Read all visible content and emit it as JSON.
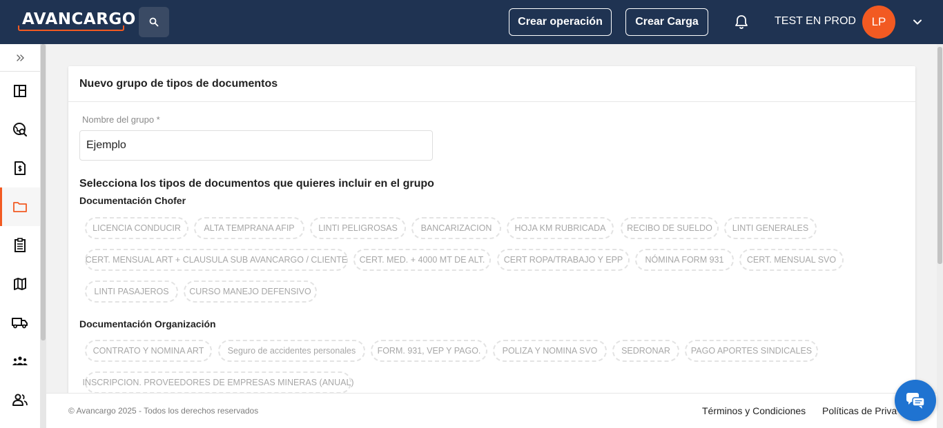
{
  "header": {
    "logo_text": "AVANCARGO",
    "search_icon": "search-icon",
    "create_operation_label": "Crear operación",
    "create_load_label": "Crear Carga",
    "notification_icon": "bell-icon",
    "user_name": "TEST EN PROD",
    "avatar_initials": "LP",
    "menu_icon": "chevron-down-icon"
  },
  "sidebar": {
    "expand_icon": "double-chevron-right-icon",
    "items": [
      {
        "icon": "dashboard-icon",
        "active": false
      },
      {
        "icon": "globe-search-icon",
        "active": false
      },
      {
        "icon": "invoice-icon",
        "active": false
      },
      {
        "icon": "folder-icon",
        "active": true
      },
      {
        "icon": "clipboard-icon",
        "active": false
      },
      {
        "icon": "map-icon",
        "active": false
      },
      {
        "icon": "truck-icon",
        "active": false
      },
      {
        "icon": "group-icon",
        "active": false
      },
      {
        "icon": "users-icon",
        "active": false
      }
    ]
  },
  "form": {
    "title": "Nuevo grupo de tipos de documentos",
    "group_name_label": "Nombre del grupo *",
    "group_name_value": "Ejemplo",
    "selection_title": "Selecciona los tipos de documentos que quieres incluir en el grupo",
    "groups": [
      {
        "title": "Documentación Chofer",
        "chips": [
          "LICENCIA CONDUCIR",
          "ALTA TEMPRANA AFIP",
          "LINTI PELIGROSAS",
          "BANCARIZACION",
          "HOJA KM RUBRICADA",
          "RECIBO DE SUELDO",
          "LINTI GENERALES",
          "CERT. MENSUAL ART + CLAUSULA SUB AVANCARGO / CLIENTE",
          "CERT. MED. + 4000 MT DE ALT.",
          "CERT ROPA/TRABAJO Y EPP",
          "NÓMINA FORM 931",
          "CERT. MENSUAL SVO",
          "LINTI PASAJEROS",
          "CURSO MANEJO DEFENSIVO"
        ]
      },
      {
        "title": "Documentación Organización",
        "chips": [
          "CONTRATO Y NOMINA ART",
          "Seguro de accidentes personales",
          "FORM. 931, VEP Y PAGO.",
          "POLIZA Y NOMINA SVO",
          "SEDRONAR",
          "PAGO APORTES SINDICALES",
          "INSCRIPCION. PROVEEDORES DE EMPRESAS MINERAS (ANUAL)"
        ]
      }
    ]
  },
  "footer": {
    "copyright": "© Avancargo 2025 - Todos los derechos reservados",
    "terms_label": "Términos y Condiciones",
    "privacy_label": "Políticas de Priva"
  },
  "chat": {
    "icon": "chat-bubbles-icon"
  },
  "colors": {
    "header_bg": "#1f3352",
    "accent": "#f25a22",
    "chat_bg": "#1f73d1"
  }
}
